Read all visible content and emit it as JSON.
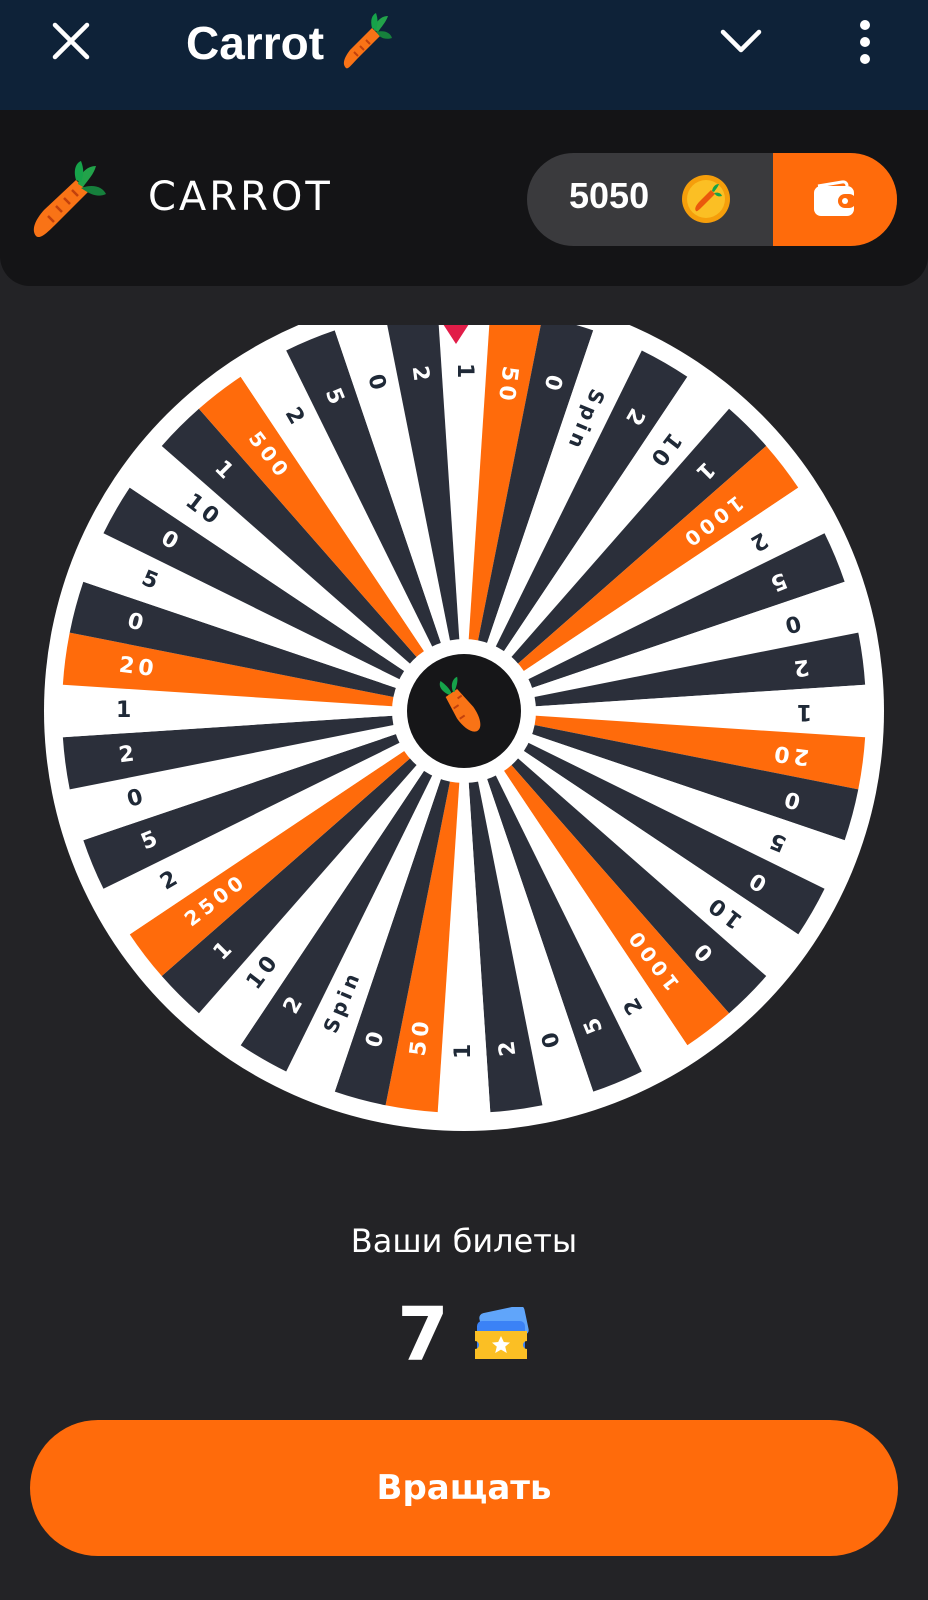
{
  "topbar": {
    "title": "Carrot",
    "close_icon": "close-icon",
    "chevron_icon": "chevron-down-icon",
    "menu_icon": "kebab-menu-icon"
  },
  "header": {
    "brand": "CARROT",
    "balance": "5050",
    "wallet_icon": "wallet-icon"
  },
  "wheel": {
    "segments": [
      "1",
      "50",
      "0",
      "Spin",
      "2",
      "10",
      "1",
      "1000",
      "2",
      "5",
      "0",
      "2",
      "1",
      "20",
      "0",
      "5",
      "0",
      "10",
      "0",
      "1000",
      "2",
      "5",
      "0",
      "2",
      "1",
      "50",
      "0",
      "Spin",
      "2",
      "10",
      "1",
      "2500",
      "2",
      "5",
      "0",
      "2",
      "1",
      "20",
      "0",
      "5",
      "0",
      "10",
      "1",
      "500",
      "2",
      "5",
      "0",
      "2"
    ],
    "colors": {
      "orange": "#ff6b0b",
      "dark": "#2b2f3a",
      "light": "#ffffff",
      "light_text": "#1f2937"
    }
  },
  "tickets": {
    "label": "Ваши билеты",
    "count": "7"
  },
  "actions": {
    "spin_label": "Вращать"
  },
  "colors": {
    "accent": "#ff6b0b",
    "topbar_bg": "#0e2238",
    "page_bg": "#232326",
    "card_bg": "#141416"
  }
}
